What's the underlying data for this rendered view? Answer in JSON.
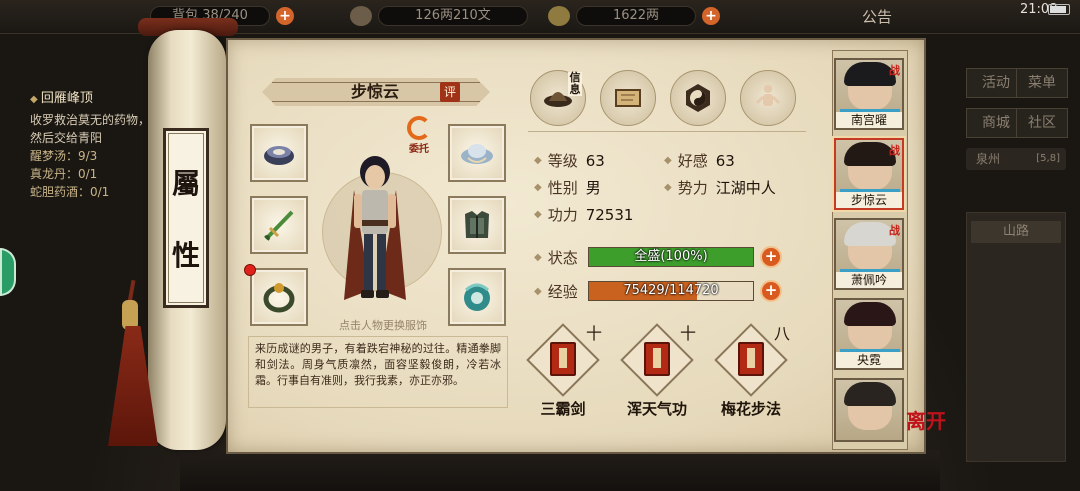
{
  "topbar": {
    "inventory": "背包 38/240",
    "copper": "126两210文",
    "silver": "1622两",
    "announce": "公告",
    "clock": "21:08"
  },
  "quest": {
    "title": "回雁峰顶",
    "desc": "收罗救治莫无的药物，然后交给青阳",
    "items": [
      "醒梦汤：9/3",
      "真龙丹：0/1",
      "蛇胆药酒：0/1"
    ]
  },
  "town": {
    "buttons": [
      "活动",
      "菜单",
      "商城",
      "社区"
    ],
    "location": "泉州",
    "coords": "[5,8]",
    "road": "山路"
  },
  "scroll": {
    "label_top": "屬",
    "label_bottom": "性"
  },
  "character": {
    "name": "步惊云",
    "rate_label": "评",
    "delegate_label": "委托",
    "tap_hint": "点击人物更换服饰",
    "bio": "来历成谜的男子，有着跌宕神秘的过往。精通拳脚和剑法。周身气质凛然，面容坚毅俊朗，冷若冰霜。行事自有准则，我行我素，亦正亦邪。"
  },
  "tabs": {
    "info_label": "信息",
    "items": [
      "info-hat-icon",
      "scroll-map-icon",
      "taiji-icon",
      "meridian-figure-icon"
    ]
  },
  "stats": {
    "level_label": "等级",
    "level": "63",
    "affection_label": "好感",
    "affection": "63",
    "gender_label": "性别",
    "gender": "男",
    "faction_label": "势力",
    "faction": "江湖中人",
    "power_label": "功力",
    "power": "72531",
    "status_label": "状态",
    "status_text": "全盛(100%)",
    "status_fraction": 1.0,
    "exp_label": "经验",
    "exp_text": "75429/114720",
    "exp_fraction": 0.6575
  },
  "skills": [
    {
      "name": "三霸剑",
      "mark": "十"
    },
    {
      "name": "浑天气功",
      "mark": "十"
    },
    {
      "name": "梅花步法",
      "mark": "八"
    }
  ],
  "roster": [
    {
      "name": "南宫曜",
      "tag": "战"
    },
    {
      "name": "步惊云",
      "tag": "战"
    },
    {
      "name": "萧佩吟",
      "tag": "战"
    },
    {
      "name": "央霓",
      "tag": ""
    },
    {
      "name": "",
      "tag": ""
    }
  ],
  "leave_label": "离开",
  "colors": {
    "status_fill": "#3d9e2c",
    "exp_fill": "#c9611f",
    "accent_red": "#a03317"
  }
}
